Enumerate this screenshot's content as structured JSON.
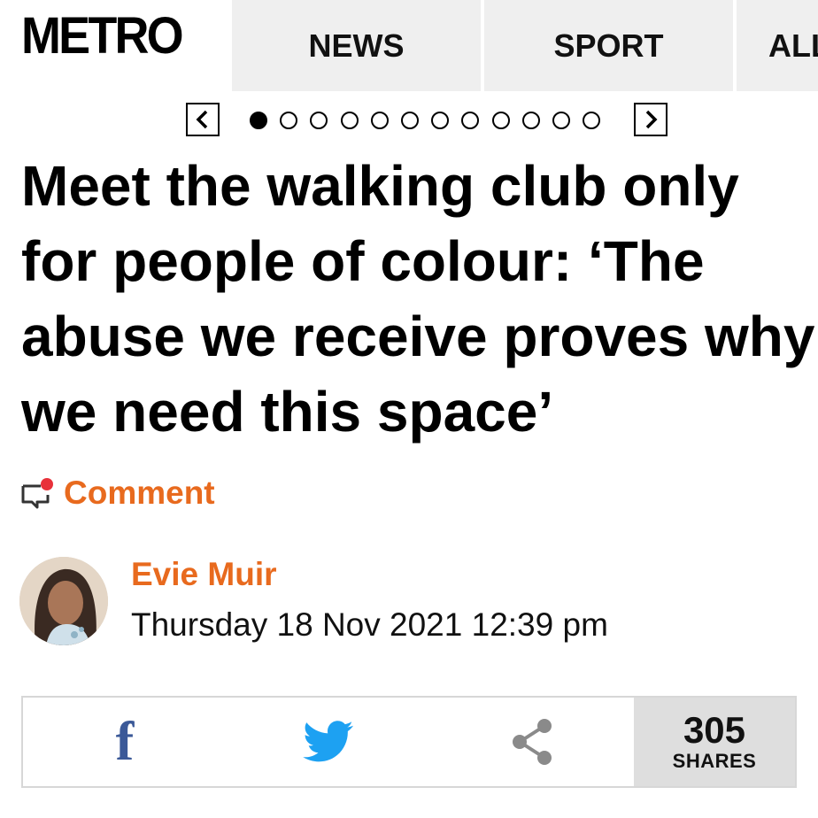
{
  "header": {
    "logo": "METRO",
    "nav": [
      {
        "label": "NEWS"
      },
      {
        "label": "SPORT"
      },
      {
        "label": "ALL"
      }
    ]
  },
  "carousel": {
    "prev_label": "<",
    "next_label": ">",
    "dot_count": 12,
    "active_index": 0
  },
  "article": {
    "headline": "Meet the walking club only\nfor people of colour: ‘The\nabuse we receive proves why\nwe need this space’",
    "comment_label": "Comment",
    "author": "Evie Muir",
    "date": "Thursday 18 Nov 2021 12:39 pm"
  },
  "share": {
    "count": "305",
    "count_label": "SHARES",
    "facebook_glyph": "f"
  },
  "colors": {
    "accent": "#e86a1e",
    "facebook": "#3b5998",
    "twitter": "#1da1f2",
    "nav_bg": "#efefef",
    "share_count_bg": "#dedede"
  }
}
